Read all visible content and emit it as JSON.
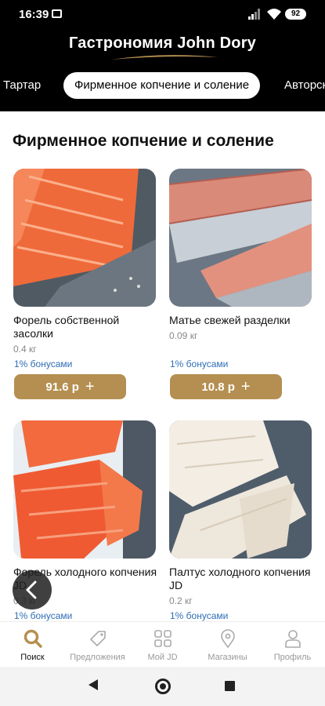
{
  "status": {
    "time": "16:39",
    "battery": "92"
  },
  "header": {
    "title": "Гастрономия John Dory"
  },
  "tabs": [
    {
      "label": "Тартар",
      "active": false
    },
    {
      "label": "Фирменное копчение и соление",
      "active": true
    },
    {
      "label": "Авторск",
      "active": false
    }
  ],
  "section": {
    "title": "Фирменное копчение и соление"
  },
  "products": [
    {
      "name": "Форель собственной засолки",
      "weight": "0.4 кг",
      "bonus": "1% бонусами",
      "price": "91.6 р",
      "image": "salted-trout-photo"
    },
    {
      "name": "Матье свежей разделки",
      "weight": "0.09 кг",
      "bonus": "1% бонусами",
      "price": "10.8 р",
      "image": "matjes-herring-photo"
    },
    {
      "name": "Форель холодного копчения JD",
      "weight": "0.3 кг",
      "bonus": "1% бонусами",
      "price": "",
      "image": "cold-smoked-trout-photo"
    },
    {
      "name": "Палтус холодного копчения JD",
      "weight": "0.2 кг",
      "bonus": "1% бонусами",
      "price": "",
      "image": "cold-smoked-halibut-photo"
    }
  ],
  "bottom_nav": [
    {
      "label": "Поиск",
      "icon": "search-icon",
      "active": true
    },
    {
      "label": "Предложения",
      "icon": "tag-icon",
      "active": false
    },
    {
      "label": "Мой JD",
      "icon": "grid-icon",
      "active": false
    },
    {
      "label": "Магазины",
      "icon": "location-pin-icon",
      "active": false
    },
    {
      "label": "Профиль",
      "icon": "user-icon",
      "active": false
    }
  ],
  "colors": {
    "accent": "#b58f51",
    "bonus": "#2f6eb5",
    "header_bg": "#000000"
  }
}
